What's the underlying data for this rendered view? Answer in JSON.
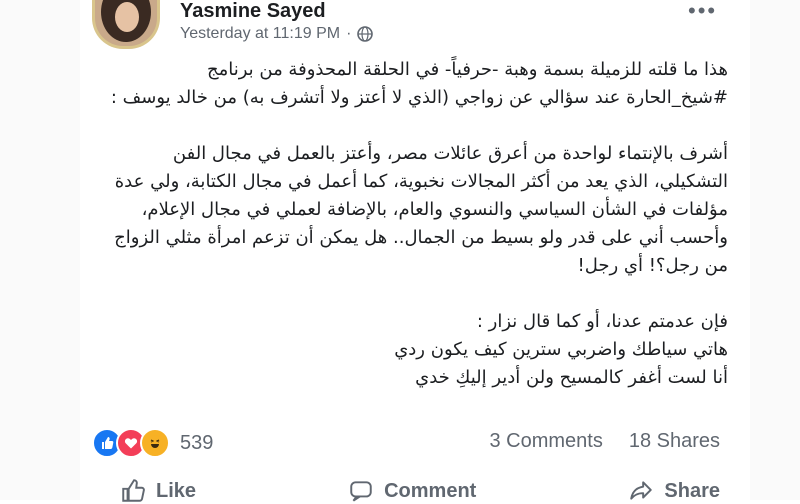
{
  "post": {
    "author": "Yasmine Sayed",
    "timestamp": "Yesterday at 11:19 PM",
    "separator": "·",
    "paragraphs": [
      "هذا ما قلته للزميلة بسمة وهبة -حرفياً- في الحلقة المحذوفة من برنامج #شيخ_الحارة عند سؤالي عن زواجي (الذي لا أعتز ولا أتشرف به) من خالد يوسف :",
      "أشرف بالإنتماء لواحدة من أعرق عائلات مصر، وأعتز بالعمل في مجال الفن التشكيلي، الذي يعد من أكثر المجالات نخبوية، كما أعمل في مجال الكتابة، ولي عدة مؤلفات في الشأن السياسي والنسوي والعام، بالإضافة لعملي في مجال الإعلام، وأحسب أني على قدر ولو بسيط من الجمال.. هل يمكن أن تزعم امرأة مثلي الزواج من رجل؟! أي رجل!",
      "فإن عدمتم عدنا، أو كما قال نزار :\nهاتي سياطك واضربي سترين كيف يكون ردي\nأنا لست أغفر كالمسيح ولن أدير إليكِ خدي"
    ]
  },
  "engagement": {
    "reaction_count": "539",
    "comments": "3 Comments",
    "shares": "18 Shares",
    "reaction_icons": [
      "like-icon",
      "love-icon",
      "haha-icon"
    ]
  },
  "actions": {
    "like": "Like",
    "comment": "Comment",
    "share": "Share"
  },
  "colors": {
    "like_blue": "#1877f2",
    "love_red": "#f33e58",
    "haha_yellow": "#f7b125",
    "meta_gray": "#606770"
  }
}
